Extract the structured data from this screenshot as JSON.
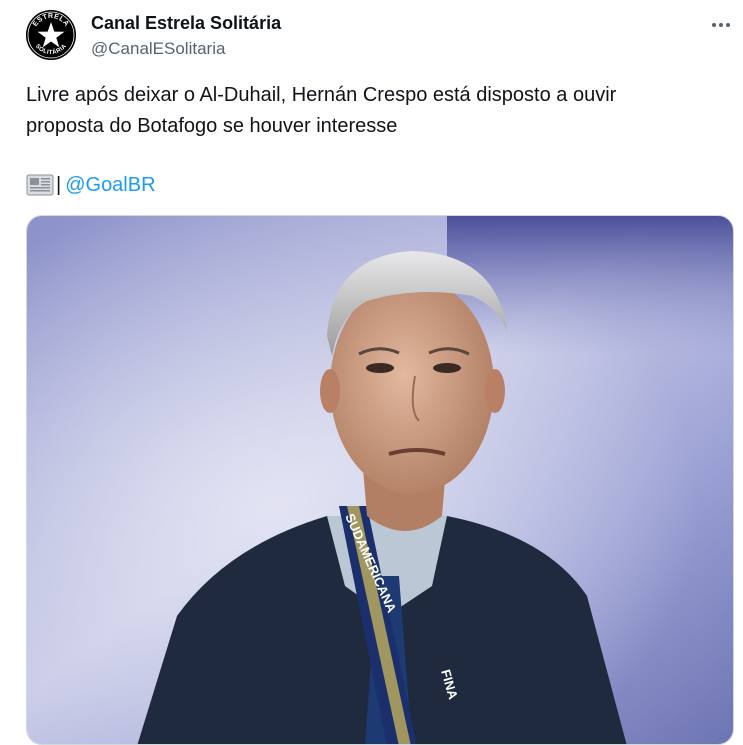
{
  "author": {
    "display_name": "Canal Estrela Solitária",
    "handle": "@CanalESolitaria",
    "avatar_text_top": "ESTRELA",
    "avatar_text_bottom": "SOLITÁRIA"
  },
  "tweet": {
    "text_line1": "Livre após deixar o Al-Duhail, Hernán Crespo está disposto a ouvir",
    "text_line2": "proposta do Botafogo se houver interesse",
    "source_icon": "newspaper-icon",
    "source_separator": "|",
    "mention": "@GoalBR"
  },
  "media": {
    "lanyard_text": "SUDAMERICANA",
    "lanyard_text2": "FINA"
  },
  "colors": {
    "link": "#1d9bf0",
    "text": "#0f1419",
    "secondary": "#536471"
  }
}
